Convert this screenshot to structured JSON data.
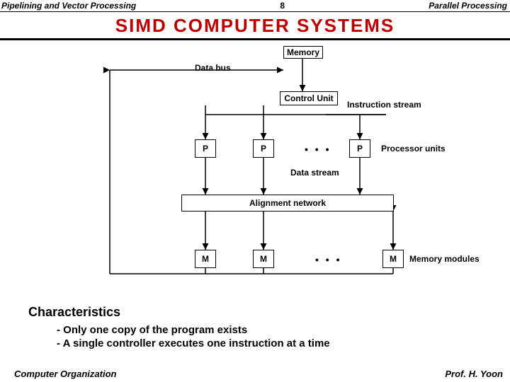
{
  "header": {
    "left": "Pipelining and Vector Processing",
    "page": "8",
    "right": "Parallel Processing"
  },
  "title": "SIMD  COMPUTER  SYSTEMS",
  "diagram": {
    "memory": "Memory",
    "databus": "Data bus",
    "control": "Control Unit",
    "instrstream": "Instruction stream",
    "p": "P",
    "procunits": "Processor units",
    "datastream": "Data stream",
    "align": "Alignment network",
    "m": "M",
    "memmods": "Memory modules",
    "dots": "• • •"
  },
  "char_header": "Characteristics",
  "bullets": {
    "b1": "- Only one copy of the program exists",
    "b2": "- A single controller executes one instruction at a time"
  },
  "footer": {
    "left": "Computer Organization",
    "right": "Prof.  H.  Yoon"
  }
}
